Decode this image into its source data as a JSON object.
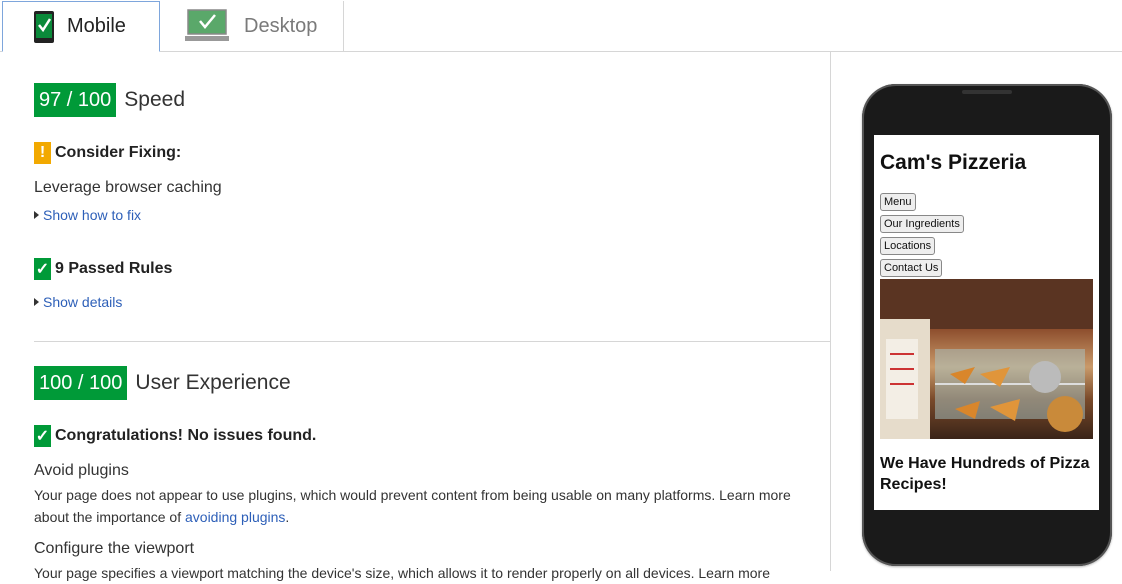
{
  "tabs": [
    {
      "label": "Mobile",
      "active": true
    },
    {
      "label": "Desktop",
      "active": false
    }
  ],
  "speed": {
    "score": "97 / 100",
    "title": "Speed",
    "consider_label": "Consider Fixing:",
    "consider_item": "Leverage browser caching",
    "show_how": "Show how to fix",
    "passed_label": "9 Passed Rules",
    "show_details": "Show details"
  },
  "ux": {
    "score": "100 / 100",
    "title": "User Experience",
    "congrats": "Congratulations! No issues found.",
    "items": [
      {
        "title": "Avoid plugins",
        "text": "Your page does not appear to use plugins, which would prevent content from being usable on many platforms. Learn more about the importance of ",
        "link": "avoiding plugins",
        "after": "."
      },
      {
        "title": "Configure the viewport",
        "text": "Your page specifies a viewport matching the device's size, which allows it to render properly on all devices. Learn more"
      }
    ]
  },
  "preview": {
    "site_title": "Cam's Pizzeria",
    "buttons": [
      "Menu",
      "Our Ingredients",
      "Locations",
      "Contact Us"
    ],
    "heading": "We Have Hundreds of Pizza Recipes!"
  },
  "colors": {
    "score_green": "#009a38",
    "warn_orange": "#f2a900",
    "link_blue": "#2d5fb8"
  },
  "icons": {
    "mobile_tab": "phone-check-icon",
    "desktop_tab": "monitor-check-icon",
    "warning": "exclamation-icon",
    "passed": "checkmark-icon",
    "expand": "triangle-right-icon"
  }
}
